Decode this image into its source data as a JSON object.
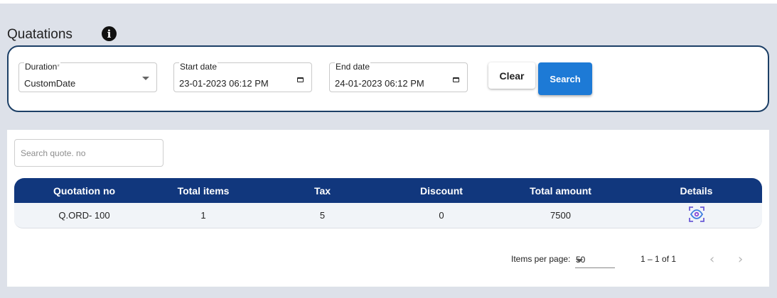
{
  "page": {
    "title": "Quatations"
  },
  "filters": {
    "duration": {
      "label": "Duration",
      "required_mark": "*",
      "value": "CustomDate"
    },
    "start_date": {
      "label": "Start date",
      "value": "23-01-2023 06:12 PM"
    },
    "end_date": {
      "label": "End date",
      "value": "24-01-2023 06:12 PM"
    },
    "clear_label": "Clear",
    "search_label": "Search"
  },
  "search": {
    "placeholder": "Search quote. no",
    "value": ""
  },
  "table": {
    "columns": [
      "Quotation no",
      "Total items",
      "Tax",
      "Discount",
      "Total amount",
      "Details"
    ],
    "rows": [
      {
        "quotation_no": "Q.ORD- 100",
        "total_items": "1",
        "tax": "5",
        "discount": "0",
        "total_amount": "7500",
        "details_icon": "view-eye-icon"
      }
    ]
  },
  "pagination": {
    "items_per_page_label": "Items per page:",
    "items_per_page": "50",
    "range": "1 – 1 of 1"
  },
  "colors": {
    "header_bg": "#11377d",
    "accent": "#1d7ad6",
    "card_border": "#1c3f66",
    "background": "#dde1e9"
  }
}
